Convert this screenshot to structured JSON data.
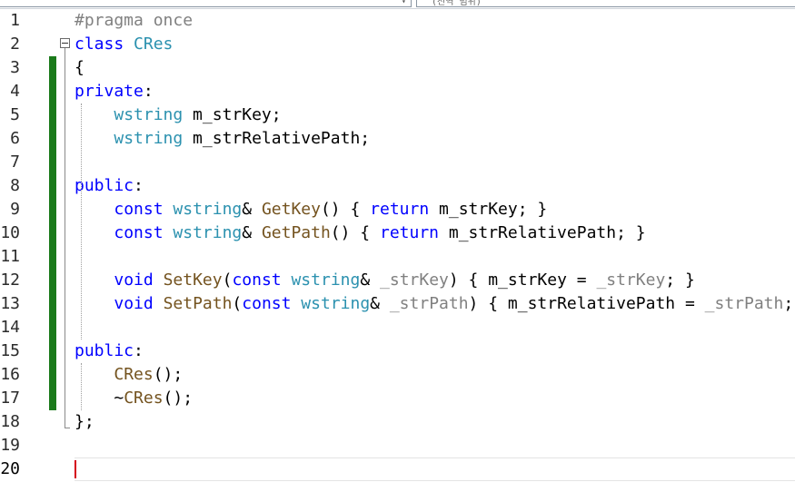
{
  "toolbar": {
    "member_combo_text": "(전역 범위)"
  },
  "editor": {
    "line_numbers": [
      "1",
      "2",
      "3",
      "4",
      "5",
      "6",
      "7",
      "8",
      "9",
      "10",
      "11",
      "12",
      "13",
      "14",
      "15",
      "16",
      "17",
      "18",
      "19",
      "20"
    ],
    "current_line": 20,
    "lines": [
      [
        [
          "pp",
          "#pragma once"
        ]
      ],
      [
        [
          "kw",
          "class"
        ],
        [
          "t",
          " "
        ],
        [
          "cls",
          "CRes"
        ]
      ],
      [
        [
          "t",
          "{"
        ]
      ],
      [
        [
          "kw",
          "private"
        ],
        [
          "t",
          ":"
        ]
      ],
      [
        [
          "t",
          "    "
        ],
        [
          "ty",
          "wstring"
        ],
        [
          "t",
          " m_strKey;"
        ]
      ],
      [
        [
          "t",
          "    "
        ],
        [
          "ty",
          "wstring"
        ],
        [
          "t",
          " m_strRelativePath;"
        ]
      ],
      [],
      [
        [
          "kw",
          "public"
        ],
        [
          "t",
          ":"
        ]
      ],
      [
        [
          "t",
          "    "
        ],
        [
          "kw",
          "const"
        ],
        [
          "t",
          " "
        ],
        [
          "ty",
          "wstring"
        ],
        [
          "t",
          "& "
        ],
        [
          "fn",
          "GetKey"
        ],
        [
          "t",
          "() { "
        ],
        [
          "kw",
          "return"
        ],
        [
          "t",
          " m_strKey; }"
        ]
      ],
      [
        [
          "t",
          "    "
        ],
        [
          "kw",
          "const"
        ],
        [
          "t",
          " "
        ],
        [
          "ty",
          "wstring"
        ],
        [
          "t",
          "& "
        ],
        [
          "fn",
          "GetPath"
        ],
        [
          "t",
          "() { "
        ],
        [
          "kw",
          "return"
        ],
        [
          "t",
          " m_strRelativePath; }"
        ]
      ],
      [],
      [
        [
          "t",
          "    "
        ],
        [
          "kw",
          "void"
        ],
        [
          "t",
          " "
        ],
        [
          "fn",
          "SetKey"
        ],
        [
          "t",
          "("
        ],
        [
          "kw",
          "const"
        ],
        [
          "t",
          " "
        ],
        [
          "ty",
          "wstring"
        ],
        [
          "t",
          "& "
        ],
        [
          "pm",
          "_strKey"
        ],
        [
          "t",
          ") { m_strKey = "
        ],
        [
          "pm",
          "_strKey"
        ],
        [
          "t",
          "; }"
        ]
      ],
      [
        [
          "t",
          "    "
        ],
        [
          "kw",
          "void"
        ],
        [
          "t",
          " "
        ],
        [
          "fn",
          "SetPath"
        ],
        [
          "t",
          "("
        ],
        [
          "kw",
          "const"
        ],
        [
          "t",
          " "
        ],
        [
          "ty",
          "wstring"
        ],
        [
          "t",
          "& "
        ],
        [
          "pm",
          "_strPath"
        ],
        [
          "t",
          ") { m_strRelativePath = "
        ],
        [
          "pm",
          "_strPath"
        ],
        [
          "t",
          "; }"
        ]
      ],
      [],
      [
        [
          "kw",
          "public"
        ],
        [
          "t",
          ":"
        ]
      ],
      [
        [
          "t",
          "    "
        ],
        [
          "fn",
          "CRes"
        ],
        [
          "t",
          "();"
        ]
      ],
      [
        [
          "t",
          "    ~"
        ],
        [
          "fn",
          "CRes"
        ],
        [
          "t",
          "();"
        ]
      ],
      [
        [
          "t",
          "};"
        ]
      ],
      [],
      []
    ]
  }
}
